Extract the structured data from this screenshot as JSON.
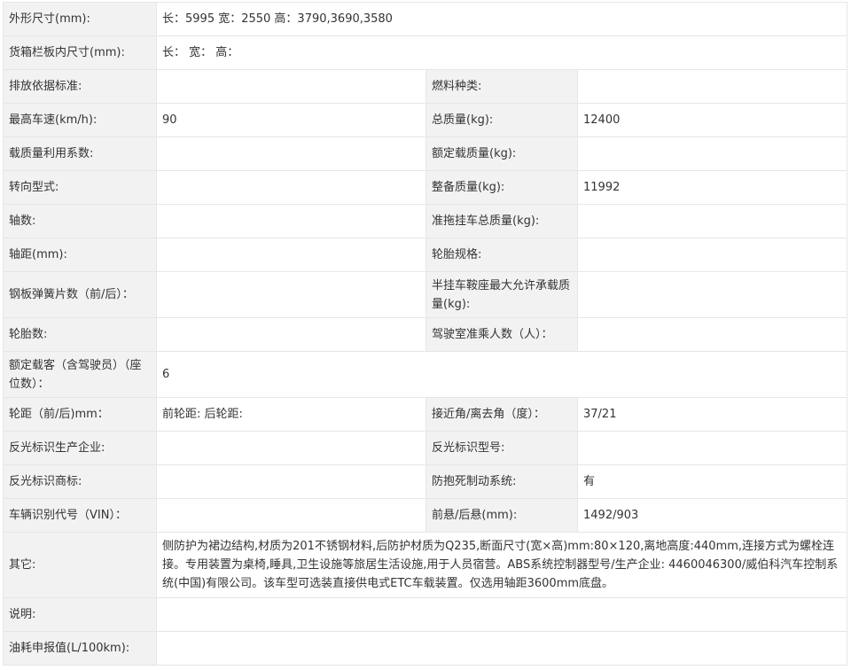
{
  "rows": [
    {
      "type": "wide",
      "h": "r38",
      "label": "外形尺寸(mm):",
      "value": "长：5995 宽：2550 高：3790,3690,3580"
    },
    {
      "type": "wide",
      "h": "r38",
      "label": "货箱栏板内尺寸(mm):",
      "value": "长：  宽：  高："
    },
    {
      "type": "pair",
      "h": "r38",
      "label1": "排放依据标准:",
      "value1": "",
      "label2": "燃料种类:",
      "value2": ""
    },
    {
      "type": "pair",
      "h": "r38",
      "label1": "最高车速(km/h):",
      "value1": "90",
      "label2": "总质量(kg):",
      "value2": "12400"
    },
    {
      "type": "pair",
      "h": "r38",
      "label1": "载质量利用系数:",
      "value1": "",
      "label2": "额定载质量(kg):",
      "value2": ""
    },
    {
      "type": "pair",
      "h": "r38",
      "label1": "转向型式:",
      "value1": "",
      "label2": "整备质量(kg):",
      "value2": "11992"
    },
    {
      "type": "pair",
      "h": "r38",
      "label1": "轴数:",
      "value1": "",
      "label2": "准拖挂车总质量(kg):",
      "value2": ""
    },
    {
      "type": "pair",
      "h": "r38",
      "label1": "轴距(mm):",
      "value1": "",
      "label2": "轮胎规格:",
      "value2": ""
    },
    {
      "type": "pair",
      "h": "r52",
      "label1": "钢板弹簧片数（前/后）：",
      "value1": "",
      "label2": "半挂车鞍座最大允许承载质量(kg):",
      "value2": ""
    },
    {
      "type": "pair",
      "h": "r38",
      "label1": "轮胎数:",
      "value1": "",
      "label2": "驾驶室准乘人数（人）：",
      "value2": ""
    },
    {
      "type": "wide",
      "h": "r52",
      "label": "额定载客（含驾驶员）（座位数）：",
      "value": "6"
    },
    {
      "type": "pair",
      "h": "r38",
      "label1": "轮距（前/后)mm：",
      "value1": "前轮距: 后轮距:",
      "label2": "接近角/离去角（度）：",
      "value2": "37/21"
    },
    {
      "type": "pair",
      "h": "r38",
      "label1": "反光标识生产企业:",
      "value1": "",
      "label2": "反光标识型号:",
      "value2": ""
    },
    {
      "type": "pair",
      "h": "r38",
      "label1": "反光标识商标:",
      "value1": "",
      "label2": "防抱死制动系统:",
      "value2": "有"
    },
    {
      "type": "pair",
      "h": "r38",
      "label1": "车辆识别代号（VIN）：",
      "value1": "",
      "label2": "前悬/后悬(mm):",
      "value2": "1492/903"
    },
    {
      "type": "wide",
      "h": "r74",
      "label": "其它:",
      "value": "侧防护为裙边结构,材质为201不锈钢材料,后防护材质为Q235,断面尺寸(宽×高)mm:80×120,离地高度:440mm,连接方式为螺栓连接。专用装置为桌椅,睡具,卫生设施等旅居生活设施,用于人员宿营。ABS系统控制器型号/生产企业: 4460046300/威伯科汽车控制系统(中国)有限公司。该车型可选装直接供电式ETC车载装置。仅选用轴距3600mm底盘。"
    },
    {
      "type": "wide",
      "h": "r38",
      "label": "说明:",
      "value": ""
    },
    {
      "type": "wide",
      "h": "r38",
      "label": "油耗申报值(L/100km):",
      "value": ""
    }
  ]
}
